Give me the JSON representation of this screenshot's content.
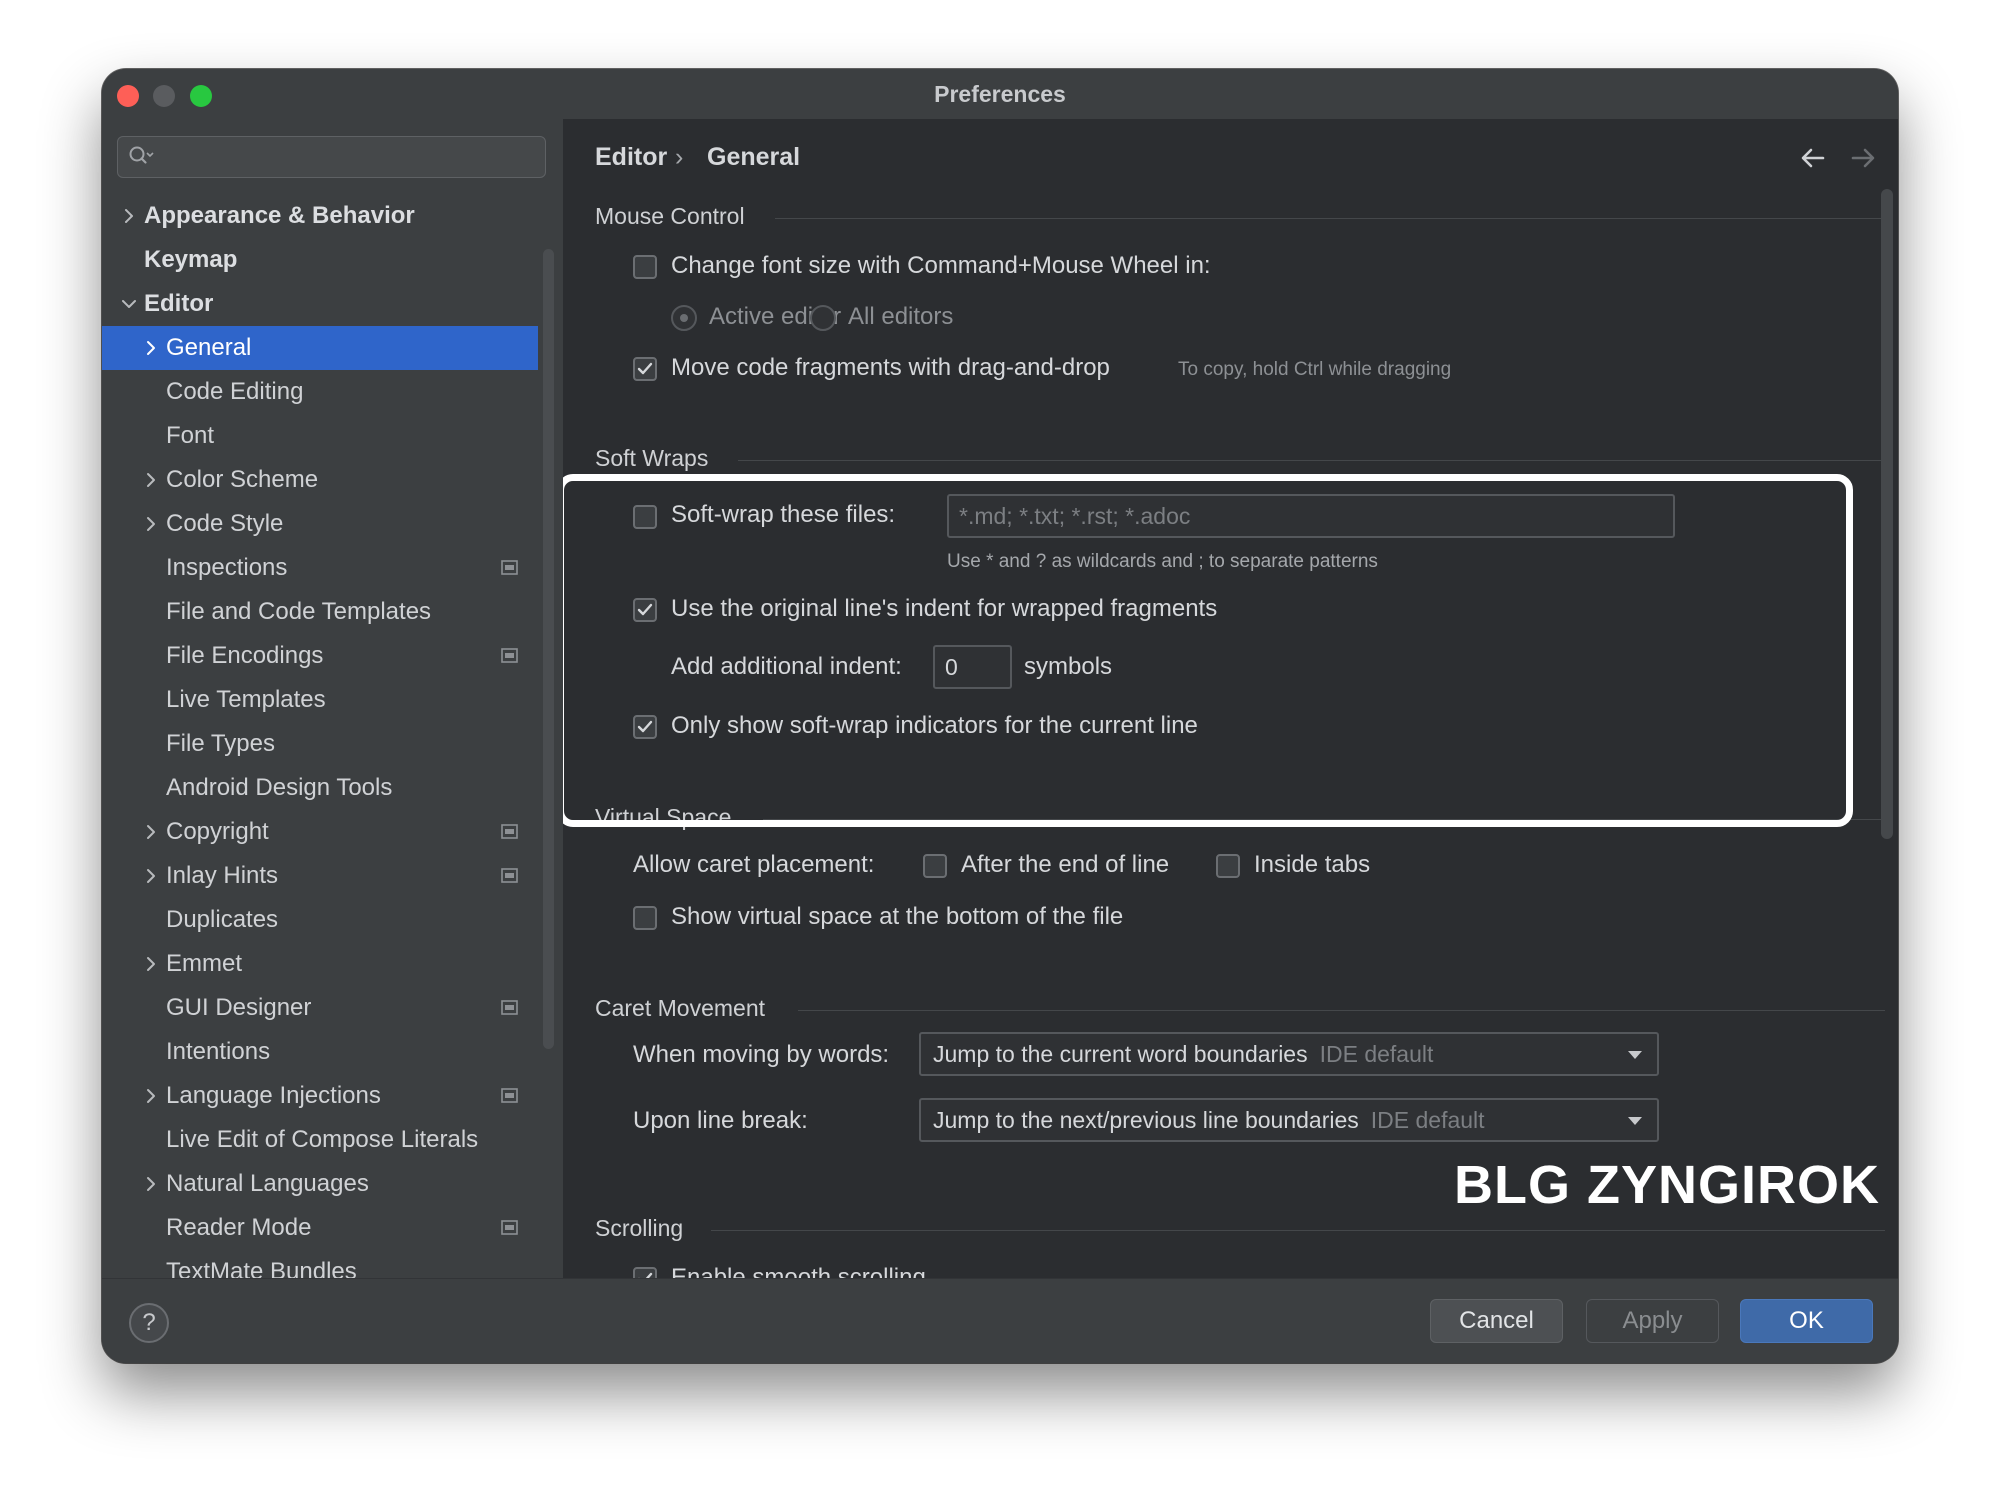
{
  "window": {
    "title": "Preferences"
  },
  "search": {
    "placeholder": ""
  },
  "sidebar": {
    "items": [
      {
        "label": "Appearance & Behavior",
        "chevron": "right",
        "bold": true,
        "indent": 0,
        "badge": false
      },
      {
        "label": "Keymap",
        "chevron": null,
        "bold": true,
        "indent": 0,
        "badge": false
      },
      {
        "label": "Editor",
        "chevron": "down",
        "bold": true,
        "indent": 0,
        "badge": false
      },
      {
        "label": "General",
        "chevron": "right",
        "bold": false,
        "indent": 1,
        "badge": false,
        "selected": true
      },
      {
        "label": "Code Editing",
        "chevron": null,
        "bold": false,
        "indent": 1,
        "badge": false
      },
      {
        "label": "Font",
        "chevron": null,
        "bold": false,
        "indent": 1,
        "badge": false
      },
      {
        "label": "Color Scheme",
        "chevron": "right",
        "bold": false,
        "indent": 1,
        "badge": false
      },
      {
        "label": "Code Style",
        "chevron": "right",
        "bold": false,
        "indent": 1,
        "badge": false
      },
      {
        "label": "Inspections",
        "chevron": null,
        "bold": false,
        "indent": 1,
        "badge": true
      },
      {
        "label": "File and Code Templates",
        "chevron": null,
        "bold": false,
        "indent": 1,
        "badge": false
      },
      {
        "label": "File Encodings",
        "chevron": null,
        "bold": false,
        "indent": 1,
        "badge": true
      },
      {
        "label": "Live Templates",
        "chevron": null,
        "bold": false,
        "indent": 1,
        "badge": false
      },
      {
        "label": "File Types",
        "chevron": null,
        "bold": false,
        "indent": 1,
        "badge": false
      },
      {
        "label": "Android Design Tools",
        "chevron": null,
        "bold": false,
        "indent": 1,
        "badge": false
      },
      {
        "label": "Copyright",
        "chevron": "right",
        "bold": false,
        "indent": 1,
        "badge": true
      },
      {
        "label": "Inlay Hints",
        "chevron": "right",
        "bold": false,
        "indent": 1,
        "badge": true
      },
      {
        "label": "Duplicates",
        "chevron": null,
        "bold": false,
        "indent": 1,
        "badge": false
      },
      {
        "label": "Emmet",
        "chevron": "right",
        "bold": false,
        "indent": 1,
        "badge": false
      },
      {
        "label": "GUI Designer",
        "chevron": null,
        "bold": false,
        "indent": 1,
        "badge": true
      },
      {
        "label": "Intentions",
        "chevron": null,
        "bold": false,
        "indent": 1,
        "badge": false
      },
      {
        "label": "Language Injections",
        "chevron": "right",
        "bold": false,
        "indent": 1,
        "badge": true
      },
      {
        "label": "Live Edit of Compose Literals",
        "chevron": null,
        "bold": false,
        "indent": 1,
        "badge": false
      },
      {
        "label": "Natural Languages",
        "chevron": "right",
        "bold": false,
        "indent": 1,
        "badge": false
      },
      {
        "label": "Reader Mode",
        "chevron": null,
        "bold": false,
        "indent": 1,
        "badge": true
      },
      {
        "label": "TextMate Bundles",
        "chevron": null,
        "bold": false,
        "indent": 1,
        "badge": false
      }
    ]
  },
  "breadcrumb": {
    "parent": "Editor",
    "separator": "›",
    "current": "General"
  },
  "mouse_control": {
    "title": "Mouse Control",
    "change_font_label": "Change font size with Command+Mouse Wheel in:",
    "change_font_checked": false,
    "active_editor_label": "Active editor",
    "active_editor_selected": true,
    "all_editors_label": "All editors",
    "all_editors_selected": false,
    "move_fragments_label": "Move code fragments with drag-and-drop",
    "move_fragments_checked": true,
    "move_fragments_hint": "To copy, hold Ctrl while dragging"
  },
  "soft_wraps": {
    "title": "Soft Wraps",
    "soft_wrap_label": "Soft-wrap these files:",
    "soft_wrap_checked": false,
    "soft_wrap_value": "*.md; *.txt; *.rst; *.adoc",
    "soft_wrap_hint": "Use * and ? as wildcards and ; to separate patterns",
    "original_indent_label": "Use the original line's indent for wrapped fragments",
    "original_indent_checked": true,
    "additional_indent_label": "Add additional indent:",
    "additional_indent_value": "0",
    "additional_indent_unit": "symbols",
    "indicators_label": "Only show soft-wrap indicators for the current line",
    "indicators_checked": true
  },
  "virtual_space": {
    "title": "Virtual Space",
    "caret_label": "Allow caret placement:",
    "after_end_label": "After the end of line",
    "after_end_checked": false,
    "inside_tabs_label": "Inside tabs",
    "inside_tabs_checked": false,
    "show_virtual_label": "Show virtual space at the bottom of the file",
    "show_virtual_checked": false
  },
  "caret_movement": {
    "title": "Caret Movement",
    "words_label": "When moving by words:",
    "words_value": "Jump to the current word boundaries",
    "words_default": "IDE default",
    "line_break_label": "Upon line break:",
    "line_break_value": "Jump to the next/previous line boundaries",
    "line_break_default": "IDE default"
  },
  "scrolling": {
    "title": "Scrolling",
    "smooth_label": "Enable smooth scrolling",
    "smooth_checked": true
  },
  "watermark": "BLG ZYNGIROK",
  "footer": {
    "help_label": "?",
    "cancel_label": "Cancel",
    "apply_label": "Apply",
    "ok_label": "OK"
  },
  "colors": {
    "accent": "#2f65ca",
    "background": "#2b2d30",
    "sidebar": "#3c3f41",
    "ok_button": "#3f6aa8",
    "highlight_border": "#ffffff"
  }
}
